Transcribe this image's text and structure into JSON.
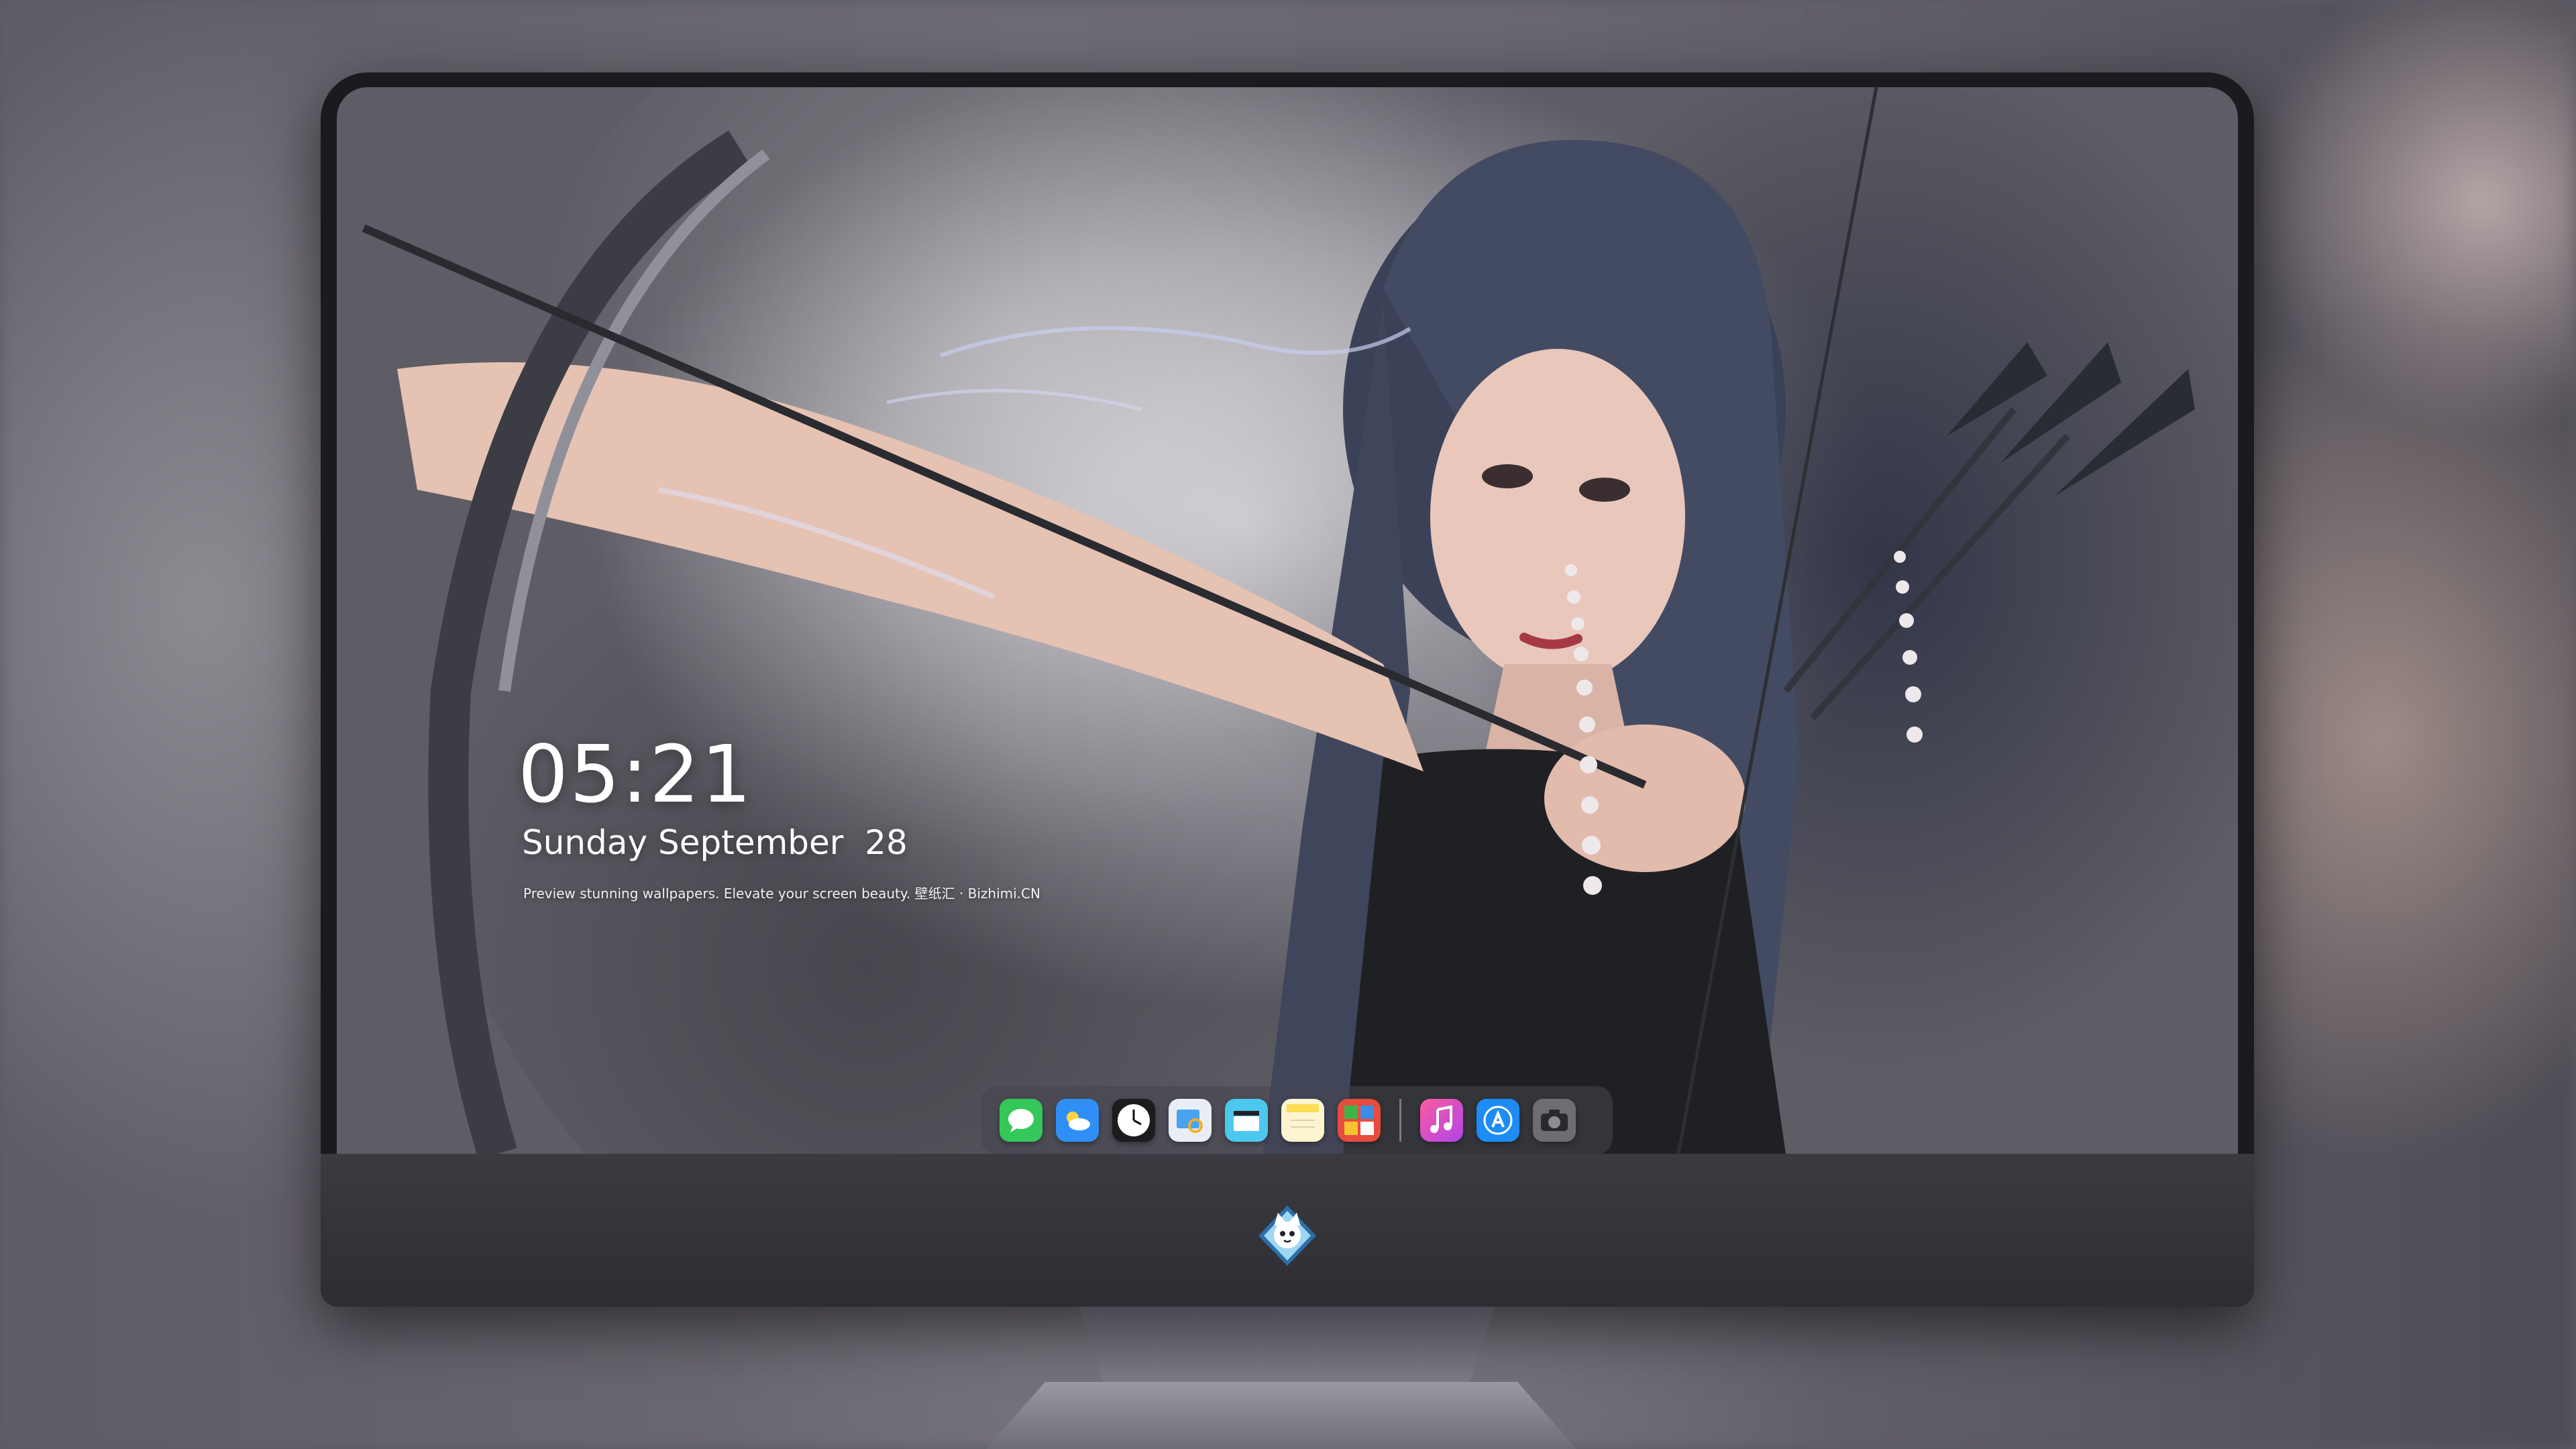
{
  "lock_screen": {
    "time": "05:21",
    "date": "Sunday September  28",
    "caption": "Preview stunning wallpapers. Elevate your screen beauty. 壁纸汇 · Bizhimi.CN"
  },
  "dock": {
    "apps": [
      {
        "name": "messages-icon",
        "color": "#34c759"
      },
      {
        "name": "weather-icon",
        "color": "#2f8ff6"
      },
      {
        "name": "clock-icon",
        "color": "#ffffff"
      },
      {
        "name": "preview-icon",
        "color": "#f0c040"
      },
      {
        "name": "clips-icon",
        "color": "#4cc7f0"
      },
      {
        "name": "notes-icon",
        "color": "#fddc54"
      },
      {
        "name": "photo-booth-icon",
        "color": "#e94b3c"
      },
      {
        "name": "music-icon",
        "color": "#f04ea0"
      },
      {
        "name": "app-store-icon",
        "color": "#1d8cf5"
      },
      {
        "name": "camera-icon",
        "color": "#6d6d72"
      }
    ]
  },
  "brand": {
    "logo": "cat-mascot-logo-icon"
  },
  "colors": {
    "monitor_bezel": "#1b1b1f",
    "chin": "#35343a",
    "dock_bg": "#464650"
  }
}
